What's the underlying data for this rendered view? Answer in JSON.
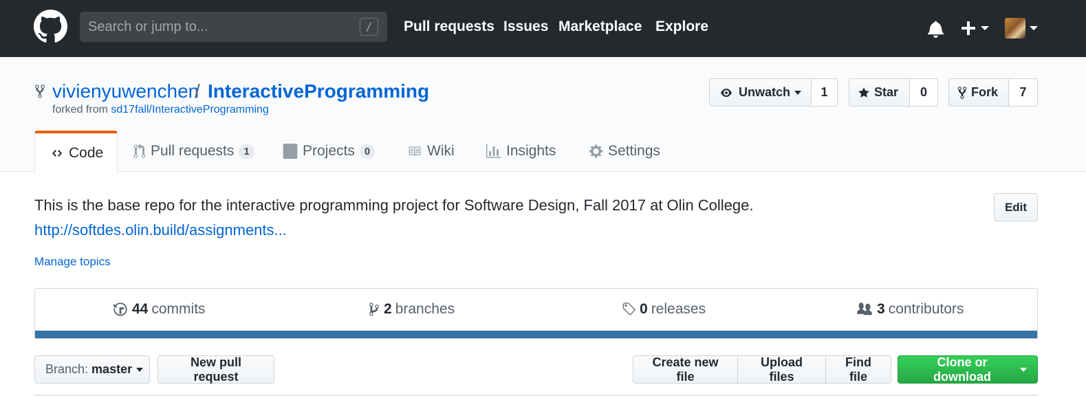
{
  "header": {
    "search_placeholder": "Search or jump to...",
    "search_shortcut": "/",
    "nav": [
      "Pull requests",
      "Issues",
      "Marketplace",
      "Explore"
    ]
  },
  "repo": {
    "owner": "vivienyuwenchen",
    "separator": "/",
    "name": "InteractiveProgramming",
    "forked_prefix": "forked from",
    "forked_source": "sd17fall/InteractiveProgramming"
  },
  "actions": {
    "watch_label": "Unwatch",
    "watch_count": "1",
    "star_label": "Star",
    "star_count": "0",
    "fork_label": "Fork",
    "fork_count": "7"
  },
  "tabs": {
    "code": "Code",
    "pull_requests": "Pull requests",
    "pull_requests_count": "1",
    "projects": "Projects",
    "projects_count": "0",
    "wiki": "Wiki",
    "insights": "Insights",
    "settings": "Settings"
  },
  "description": {
    "text": "This is the base repo for the interactive programming project for Software Design, Fall 2017 at Olin College.",
    "link": "http://softdes.olin.build/assignments...",
    "manage_topics": "Manage topics",
    "edit_label": "Edit"
  },
  "summary": {
    "commits_count": "44",
    "commits_label": "commits",
    "branches_count": "2",
    "branches_label": "branches",
    "releases_count": "0",
    "releases_label": "releases",
    "contributors_count": "3",
    "contributors_label": "contributors",
    "language_color": "#3572a5"
  },
  "file_nav": {
    "branch_prefix": "Branch:",
    "branch_name": "master",
    "new_pr": "New pull request",
    "create_file": "Create new file",
    "upload_files": "Upload files",
    "find_file": "Find file",
    "clone": "Clone or download"
  },
  "colors": {
    "header_bg": "#24292e",
    "link": "#0366d6",
    "tab_accent": "#e36209",
    "clone_green": "#28a745"
  }
}
